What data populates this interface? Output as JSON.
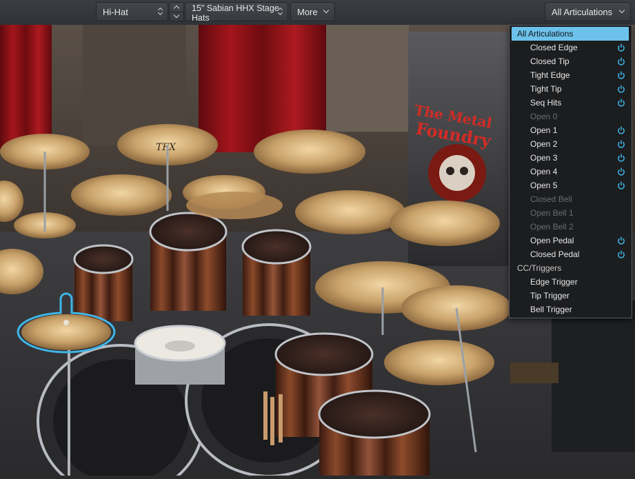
{
  "toolbar": {
    "instrument": "Hi-Hat",
    "model_line1": "15\" Sabian HHX Stage",
    "model_line2": "Hats",
    "more": "More",
    "articulation_filter": "All Articulations"
  },
  "kit": {
    "banner_line1": "The Metal",
    "banner_line2": "Foundry",
    "cymbal_logo": "TFX"
  },
  "menu": {
    "items": [
      {
        "label": "All Articulations",
        "kind": "selected",
        "power": false
      },
      {
        "label": "Closed Edge",
        "kind": "sub",
        "power": true
      },
      {
        "label": "Closed Tip",
        "kind": "sub",
        "power": true
      },
      {
        "label": "Tight Edge",
        "kind": "sub",
        "power": true
      },
      {
        "label": "Tight Tip",
        "kind": "sub",
        "power": true
      },
      {
        "label": "Seq Hits",
        "kind": "sub",
        "power": true
      },
      {
        "label": "Open 0",
        "kind": "disabled",
        "power": false
      },
      {
        "label": "Open 1",
        "kind": "sub",
        "power": true
      },
      {
        "label": "Open 2",
        "kind": "sub",
        "power": true
      },
      {
        "label": "Open 3",
        "kind": "sub",
        "power": true
      },
      {
        "label": "Open 4",
        "kind": "sub",
        "power": true
      },
      {
        "label": "Open 5",
        "kind": "sub",
        "power": true
      },
      {
        "label": "Closed Bell",
        "kind": "disabled",
        "power": false
      },
      {
        "label": "Open Bell 1",
        "kind": "disabled",
        "power": false
      },
      {
        "label": "Open Bell 2",
        "kind": "disabled",
        "power": false
      },
      {
        "label": "Open Pedal",
        "kind": "sub",
        "power": true
      },
      {
        "label": "Closed Pedal",
        "kind": "sub",
        "power": true
      },
      {
        "label": "CC/Triggers",
        "kind": "header",
        "power": false
      },
      {
        "label": "Edge Trigger",
        "kind": "sub",
        "power": false
      },
      {
        "label": "Tip Trigger",
        "kind": "sub",
        "power": false
      },
      {
        "label": "Bell Trigger",
        "kind": "sub",
        "power": false
      }
    ],
    "power_icon": "power-icon"
  },
  "colors": {
    "accent": "#3fb6e8",
    "selection": "#6cc2ea",
    "curtain": "#8e1016"
  }
}
